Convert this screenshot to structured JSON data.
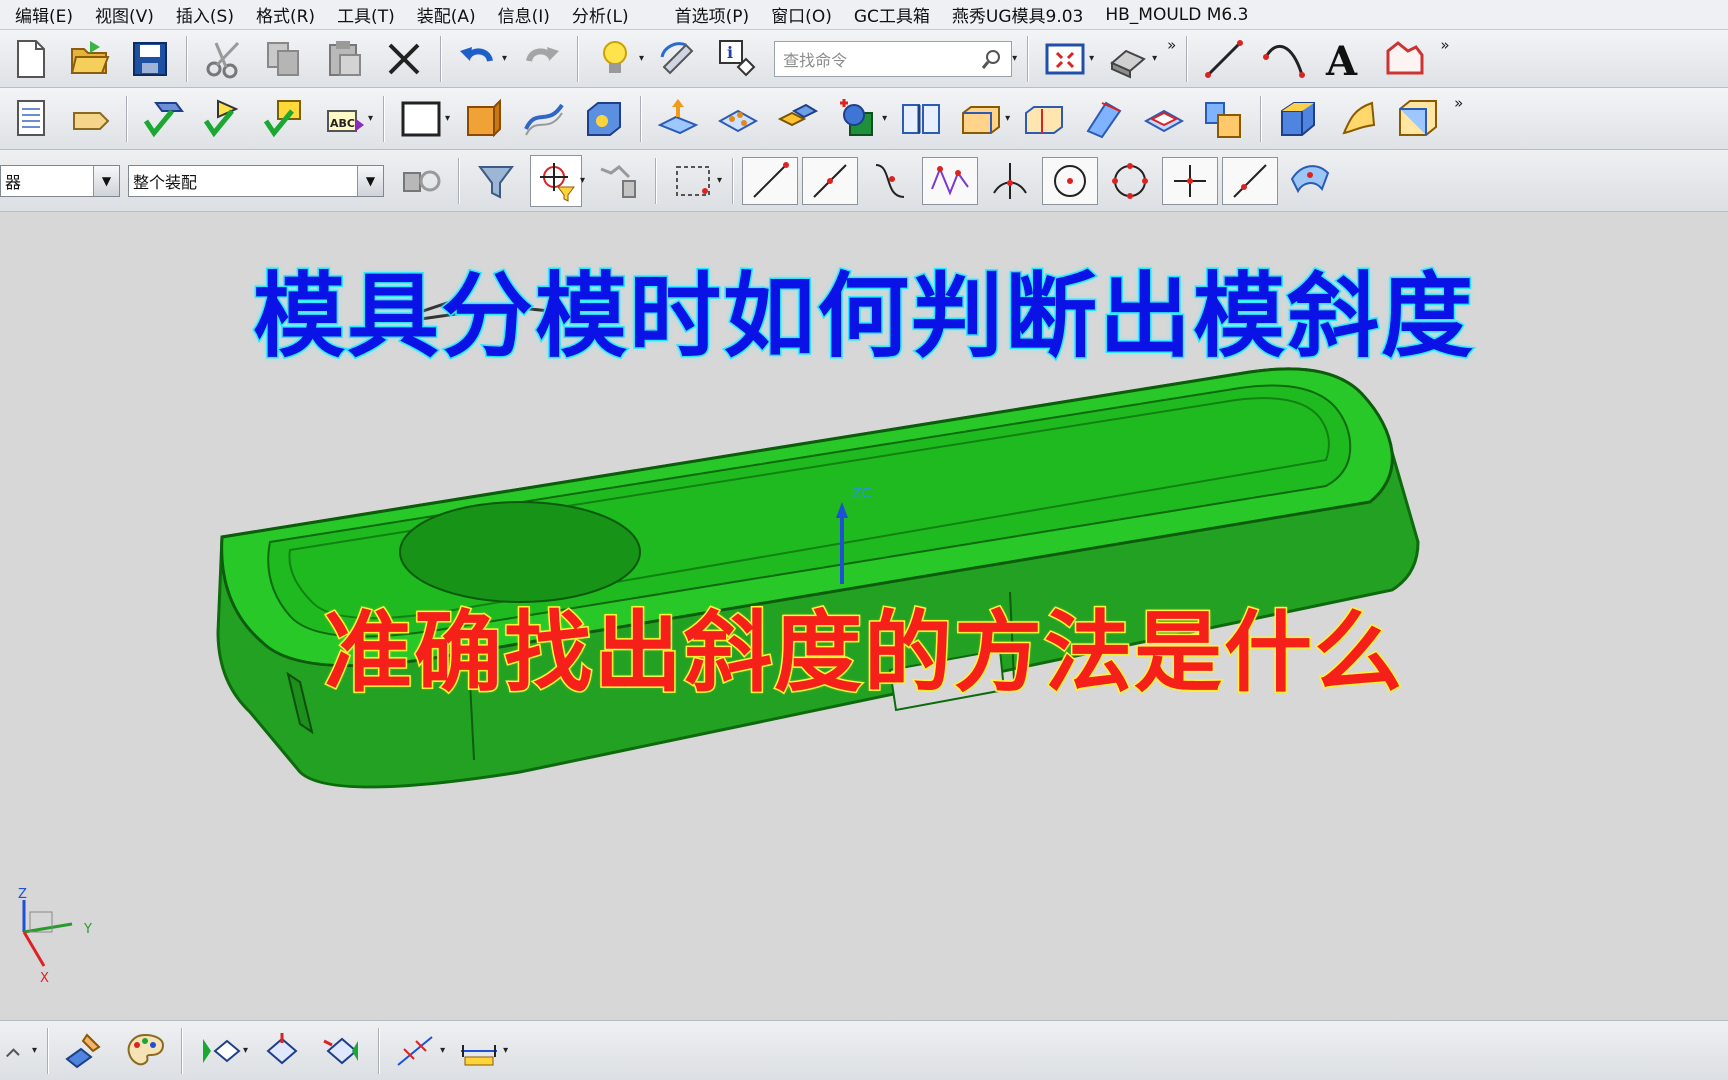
{
  "menu": {
    "items": [
      "编辑(E)",
      "视图(V)",
      "插入(S)",
      "格式(R)",
      "工具(T)",
      "装配(A)",
      "信息(I)",
      "分析(L)",
      "首选项(P)",
      "窗口(O)",
      "GC工具箱",
      "燕秀UG模具9.03",
      "HB_MOULD M6.3"
    ]
  },
  "search": {
    "placeholder": "查找命令"
  },
  "filters": {
    "type_filter": "器",
    "scope_filter": "整个装配"
  },
  "viewport": {
    "title_main": "模具分模时如何判断出模斜度",
    "title_sub": "准确找出斜度的方法是什么",
    "zc_label": "ZC",
    "triad": {
      "z": "Z",
      "y": "Y",
      "x": "X"
    }
  },
  "colors": {
    "title_main": "#0b12e6",
    "title_main_outline": "#16e6ff",
    "title_sub": "#f5201a",
    "title_sub_outline": "#fff23a",
    "model": "#1fb81f"
  },
  "icons": {
    "toolbar1": [
      "new-file-icon",
      "open-folder-icon",
      "save-icon",
      "cut-icon",
      "copy-icon",
      "paste-icon",
      "delete-icon",
      "undo-icon",
      "redo-icon",
      "lightbulb-icon",
      "rotate-icon",
      "info-icon",
      "search-icon",
      "fit-view-icon",
      "shaded-view-icon",
      "line-icon",
      "arc-icon",
      "text-icon",
      "shape-icon"
    ],
    "toolbar2": [
      "layer-icon",
      "label-icon",
      "check-icon",
      "check-icon",
      "check-icon",
      "spell-icon",
      "rectangle-icon",
      "extrude-icon",
      "surface-icon",
      "block-icon",
      "move-face-icon",
      "pattern-icon",
      "assembly-icon",
      "boolean-icon",
      "book-icon",
      "block-icon",
      "block-icon",
      "sweep-icon",
      "pad-icon",
      "union-icon",
      "block-icon",
      "sheet-icon",
      "box-icon"
    ],
    "toolbar3": [
      "assembly-filter-icon",
      "funnel-icon",
      "target-icon",
      "chain-icon",
      "select-box-icon",
      "endpoint-icon",
      "midpoint-icon",
      "curve-icon",
      "control-point-icon",
      "intersection-icon",
      "center-icon",
      "quadrant-icon",
      "point-icon",
      "on-curve-icon",
      "surface-point-icon"
    ],
    "bottom": [
      "measure-icon",
      "paint-icon",
      "palette-icon",
      "view-icon",
      "view-icon",
      "view-icon",
      "dimension-icon",
      "ruler-icon"
    ]
  }
}
